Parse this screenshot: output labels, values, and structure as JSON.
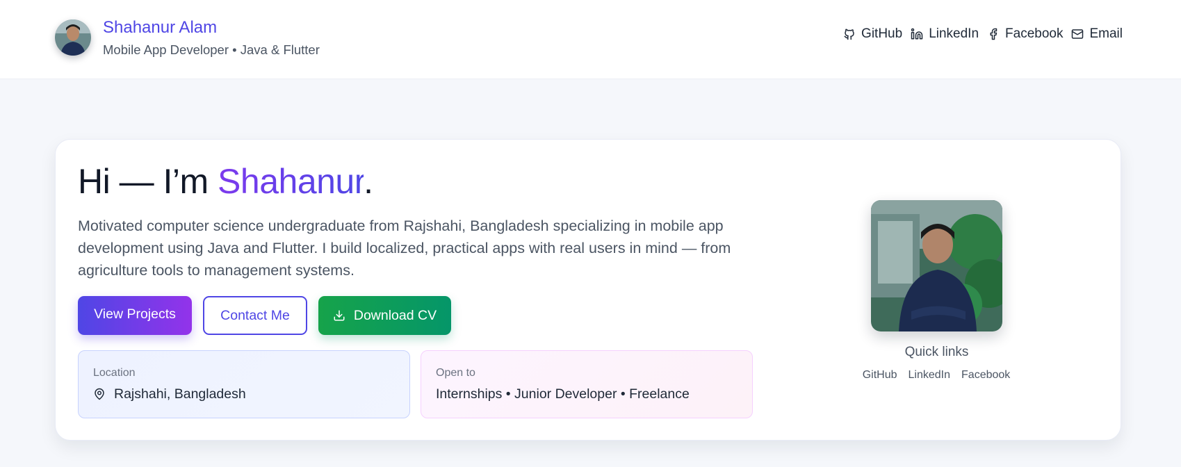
{
  "header": {
    "name": "Shahanur Alam",
    "subtitle": "Mobile App Developer • Java & Flutter",
    "nav": [
      {
        "label": "GitHub",
        "icon": "github-icon"
      },
      {
        "label": "LinkedIn",
        "icon": "linkedin-icon"
      },
      {
        "label": "Facebook",
        "icon": "facebook-icon"
      },
      {
        "label": "Email",
        "icon": "mail-icon"
      }
    ]
  },
  "hero": {
    "greeting": "Hi — I’m ",
    "name": "Shahanur",
    "period": ".",
    "description": "Motivated computer science undergraduate from Rajshahi, Bangladesh specializing in mobile app development using Java and Flutter. I build localized, practical apps with real users in mind — from agriculture tools to management systems.",
    "buttons": {
      "view_projects": "View Projects",
      "contact": "Contact Me",
      "download_cv": "Download CV"
    },
    "location": {
      "label": "Location",
      "value": "Rajshahi, Bangladesh"
    },
    "open_to": {
      "label": "Open to",
      "value": "Internships • Junior Developer • Freelance"
    }
  },
  "quick_links": {
    "title": "Quick links",
    "items": [
      "GitHub",
      "LinkedIn",
      "Facebook"
    ]
  },
  "colors": {
    "accent": "#4f46e5",
    "accent_purple": "#9333ea",
    "green": "#16a34a",
    "background": "#f5f7fb"
  }
}
